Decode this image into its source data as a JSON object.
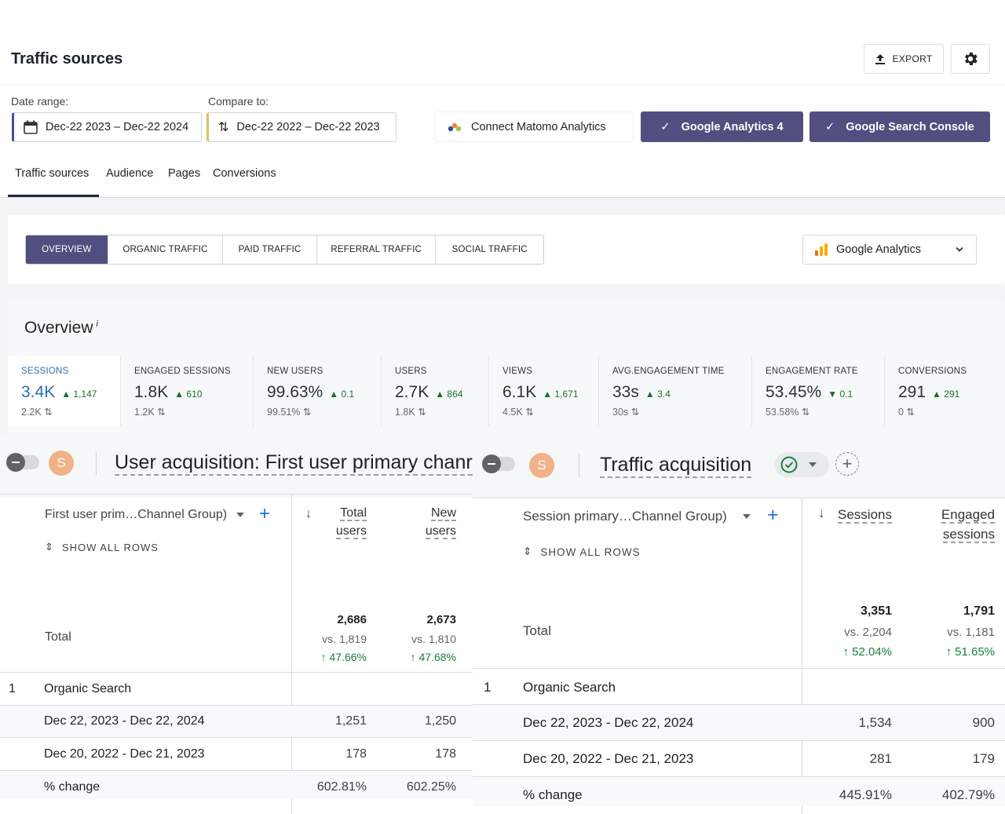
{
  "header": {
    "title": "Traffic sources",
    "export_label": "EXPORT"
  },
  "filters": {
    "date_range_label": "Date range:",
    "date_range_value": "Dec-22 2023 – Dec-22 2024",
    "compare_label": "Compare to:",
    "compare_value": "Dec-22 2022 – Dec-22 2023",
    "connect_label": "Connect Matomo Analytics",
    "ga4_label": "Google Analytics 4",
    "gsc_label": "Google Search Console"
  },
  "tabs": [
    "Traffic sources",
    "Audience",
    "Pages",
    "Conversions"
  ],
  "segments": [
    "OVERVIEW",
    "ORGANIC TRAFFIC",
    "PAID TRAFFIC",
    "REFERRAL TRAFFIC",
    "SOCIAL TRAFFIC"
  ],
  "source_select": "Google Analytics",
  "overview": {
    "title": "Overview",
    "info": "i",
    "metrics": [
      {
        "label": "SESSIONS",
        "value": "3.4K",
        "delta": "1,147",
        "prev": "2.2K"
      },
      {
        "label": "ENGAGED SESSIONS",
        "value": "1.8K",
        "delta": "610",
        "prev": "1.2K"
      },
      {
        "label": "NEW USERS",
        "value": "99.63%",
        "delta": "0.1",
        "prev": "99.51%"
      },
      {
        "label": "USERS",
        "value": "2.7K",
        "delta": "864",
        "prev": "1.8K"
      },
      {
        "label": "VIEWS",
        "value": "6.1K",
        "delta": "1,671",
        "prev": "4.5K"
      },
      {
        "label": "AVG.ENGAGEMENT TIME",
        "value": "33s",
        "delta": "3.4",
        "prev": "30s"
      },
      {
        "label": "ENGAGEMENT RATE",
        "value": "53.45%",
        "delta": "0.1",
        "prev": "53.58%"
      },
      {
        "label": "CONVERSIONS",
        "value": "291",
        "delta": "291",
        "prev": "0"
      }
    ]
  },
  "user_acquisition": {
    "avatar": "S",
    "title": "User acquisition: First user primary chanr",
    "dimension": "First user prim…Channel Group)",
    "show_all": "SHOW ALL ROWS",
    "col1_l1": "Total",
    "col1_l2": "users",
    "col2_l1": "New",
    "col2_l2": "users",
    "total_label": "Total",
    "totals": {
      "c1": "2,686",
      "c2": "2,673",
      "vs1": "vs. 1,819",
      "vs2": "vs. 1,810",
      "pct1": "↑ 47.66%",
      "pct2": "↑ 47.68%"
    },
    "group_index": "1",
    "group_name": "Organic Search",
    "rows": [
      {
        "label": "Dec 22, 2023 - Dec 22, 2024",
        "c1": "1,251",
        "c2": "1,250"
      },
      {
        "label": "Dec 20, 2022 - Dec 21, 2023",
        "c1": "178",
        "c2": "178"
      },
      {
        "label": "% change",
        "c1": "602.81%",
        "c2": "602.25%"
      }
    ]
  },
  "traffic_acquisition": {
    "avatar": "S",
    "title": "Traffic acquisition",
    "dimension": "Session primary…Channel Group)",
    "show_all": "SHOW ALL ROWS",
    "col1_l1": "Sessions",
    "col2_l1": "Engaged",
    "col2_l2": "sessions",
    "total_label": "Total",
    "totals": {
      "c1": "3,351",
      "c2": "1,791",
      "vs1": "vs. 2,204",
      "vs2": "vs. 1,181",
      "pct1": "↑ 52.04%",
      "pct2": "↑ 51.65%"
    },
    "group_index": "1",
    "group_name": "Organic Search",
    "rows": [
      {
        "label": "Dec 22, 2023 - Dec 22, 2024",
        "c1": "1,534",
        "c2": "900"
      },
      {
        "label": "Dec 20, 2022 - Dec 21, 2023",
        "c1": "281",
        "c2": "179"
      },
      {
        "label": "% change",
        "c1": "445.91%",
        "c2": "402.79%"
      }
    ]
  },
  "colors": {
    "accent": "#514f80",
    "positive": "#188038",
    "link": "#2d6fb5"
  }
}
